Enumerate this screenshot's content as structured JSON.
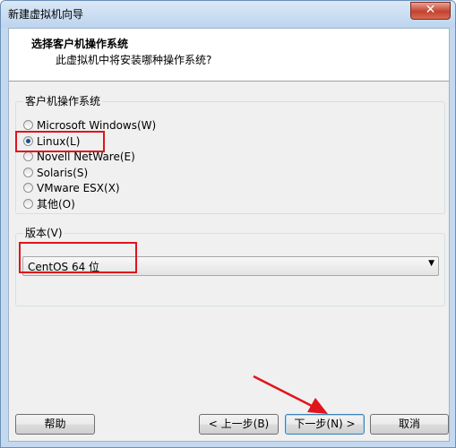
{
  "window": {
    "title": "新建虚拟机向导",
    "close_glyph": "✕"
  },
  "header": {
    "title": "选择客户机操作系统",
    "subtitle": "此虚拟机中将安装哪种操作系统?"
  },
  "os_group": {
    "label": "客户机操作系统",
    "options": [
      {
        "label": "Microsoft Windows(W)",
        "checked": false
      },
      {
        "label": "Linux(L)",
        "checked": true
      },
      {
        "label": "Novell NetWare(E)",
        "checked": false
      },
      {
        "label": "Solaris(S)",
        "checked": false
      },
      {
        "label": "VMware ESX(X)",
        "checked": false
      },
      {
        "label": "其他(O)",
        "checked": false
      }
    ]
  },
  "version_group": {
    "label": "版本(V)",
    "selected": "CentOS 64 位",
    "arrow": "▼"
  },
  "buttons": {
    "help": "帮助",
    "back": "< 上一步(B)",
    "next": "下一步(N) >",
    "cancel": "取消"
  },
  "annotation_colors": {
    "highlight": "#e0141c"
  }
}
